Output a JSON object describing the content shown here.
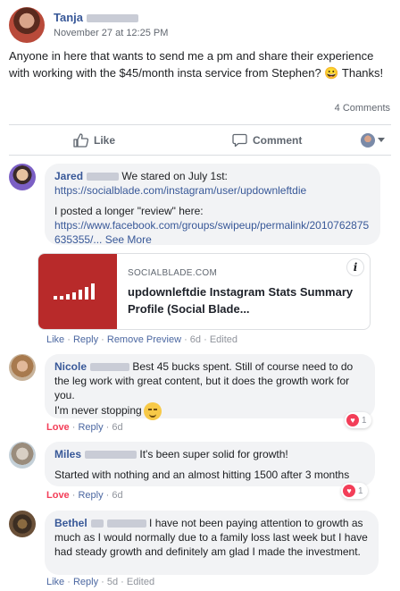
{
  "post": {
    "author": "Tanja",
    "time": "November 27 at 12:25 PM",
    "text": "Anyone in here that wants to send me a pm and share their experience with working with the $45/month insta service from Stephen? 😀 Thanks!",
    "comments_count": "4 Comments"
  },
  "actions": {
    "like": "Like",
    "comment": "Comment"
  },
  "comments": [
    {
      "name": "Jared",
      "line1": "We stared on July 1st:",
      "link1": "https://socialblade.com/instagram/user/updownleftdie",
      "line2": "I posted a longer \"review\" here:",
      "link2": "https://www.facebook.com/groups/swipeup/permalink/2010762875635355/...",
      "see_more": "See More",
      "card": {
        "domain": "SOCIALBLADE.COM",
        "title": "updownleftdie Instagram Stats Summary Profile (Social Blade..."
      },
      "meta": {
        "like": "Like",
        "reply": "Reply",
        "remove_preview": "Remove Preview",
        "time": "6d",
        "edited": "Edited"
      }
    },
    {
      "name": "Nicole",
      "text": "Best 45 bucks spent. Still of course need to do the leg work with great content, but it does the growth work for you.",
      "text2": "I'm never stopping",
      "reactions": "1",
      "meta": {
        "love": "Love",
        "reply": "Reply",
        "time": "6d"
      }
    },
    {
      "name": "Miles",
      "text": "It's been super solid for growth!",
      "text2": "Started with nothing and an almost hitting 1500 after 3 months",
      "reactions": "1",
      "meta": {
        "love": "Love",
        "reply": "Reply",
        "time": "6d"
      }
    },
    {
      "name": "Bethel",
      "text": "I have not been paying attention to growth as much as I would normally due to a family loss last week but I have had steady growth and definitely am glad I made the investment.",
      "meta": {
        "like": "Like",
        "reply": "Reply",
        "time": "5d",
        "edited": "Edited"
      }
    }
  ],
  "colors": {
    "link": "#385898",
    "love": "#f33e58",
    "bubble": "#f2f3f5"
  }
}
